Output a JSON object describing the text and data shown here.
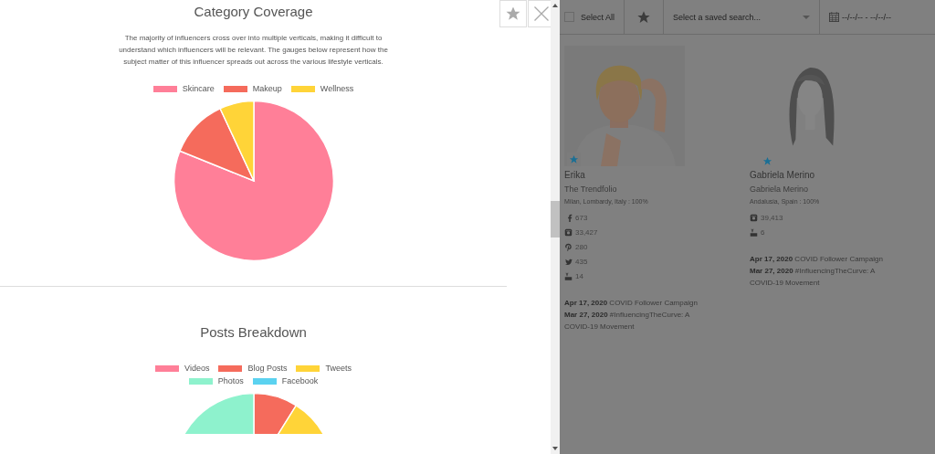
{
  "panel": {
    "sections": [
      {
        "title": "Category Coverage",
        "description": "The majority of influencers cross over into multiple verticals, making it difficult to understand which influencers will be relevant. The gauges below represent how the subject matter of this influencer spreads out across the various lifestyle verticals.",
        "kind": "pie",
        "legend": [
          {
            "label": "Skincare",
            "color": "#ff7f98"
          },
          {
            "label": "Makeup",
            "color": "#f56b5c"
          },
          {
            "label": "Wellness",
            "color": "#ffd438"
          }
        ]
      },
      {
        "title": "Posts Breakdown",
        "kind": "donut",
        "legend": [
          {
            "label": "Videos",
            "color": "#ff7f98"
          },
          {
            "label": "Blog Posts",
            "color": "#f56b5c"
          },
          {
            "label": "Tweets",
            "color": "#ffd438"
          },
          {
            "label": "Photos",
            "color": "#8ef2cd"
          },
          {
            "label": "Facebook",
            "color": "#5bd2f0"
          }
        ]
      }
    ]
  },
  "toolbar": {
    "select_all": {
      "label": "Select All",
      "checked": false
    },
    "saved_search": {
      "placeholder": "Select a saved search..."
    },
    "date_range": {
      "placeholder": "--/--/-- - --/--/--"
    }
  },
  "cards": [
    {
      "name": "Erika",
      "outlet": "The Trendfolio",
      "location": "Milan, Lombardy, Italy : 100%",
      "starred": true,
      "socials": [
        {
          "kind": "facebook",
          "count": "673"
        },
        {
          "kind": "instagram",
          "count": "33,427"
        },
        {
          "kind": "pinterest",
          "count": "280"
        },
        {
          "kind": "twitter",
          "count": "435"
        },
        {
          "kind": "youtube",
          "count": "14"
        }
      ],
      "posts": [
        {
          "date": "Apr 17, 2020",
          "title": "COVID Follower Campaign"
        },
        {
          "date": "Mar 27, 2020",
          "title": "#InfluencingTheCurve: A COVID-19 Movement"
        }
      ]
    },
    {
      "name": "Gabriela Merino",
      "outlet": "Gabriela Merino",
      "location": "Andalusia, Spain : 100%",
      "starred": true,
      "socials": [
        {
          "kind": "instagram",
          "count": "39,413"
        },
        {
          "kind": "youtube",
          "count": "6"
        }
      ],
      "posts": [
        {
          "date": "Apr 17, 2020",
          "title": "COVID Follower Campaign"
        },
        {
          "date": "Mar 27, 2020",
          "title": "#InfluencingTheCurve: A COVID-19 Movement"
        }
      ]
    }
  ]
}
